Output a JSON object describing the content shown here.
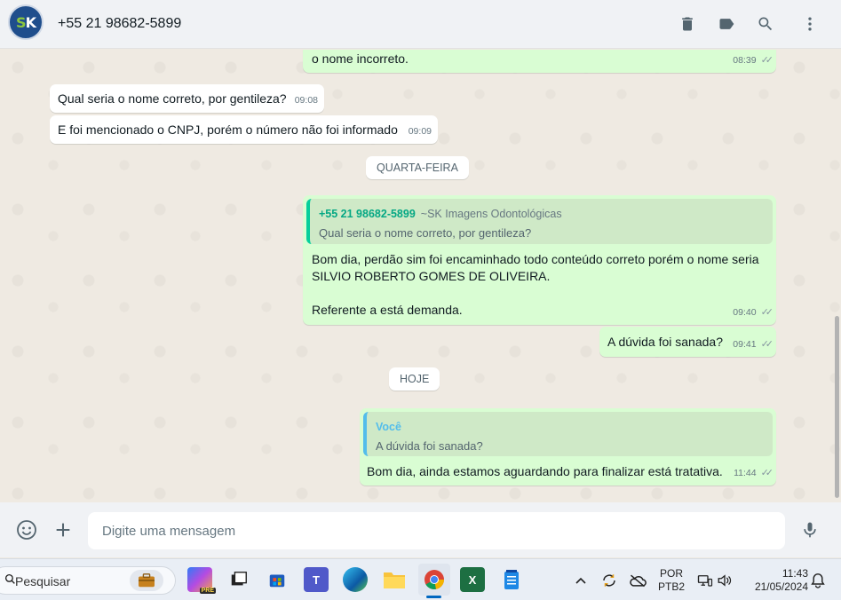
{
  "header": {
    "contact_name": "+55 21 98682-5899",
    "avatar_text_s": "S",
    "avatar_text_k": "K",
    "icons": [
      "delete-icon",
      "label-icon",
      "search-icon",
      "menu-icon"
    ]
  },
  "messages": [
    {
      "direction": "out",
      "text": "o nome incorreto.",
      "time": "08:39",
      "ticks": "✓✓"
    },
    {
      "direction": "in",
      "text": "Qual seria o nome correto, por gentileza?",
      "time": "09:08"
    },
    {
      "direction": "in",
      "text": "E foi mencionado o CNPJ, porém o número não foi informado",
      "time": "09:09"
    },
    {
      "direction": "out",
      "quote": {
        "author": "+55 21 98682-5899",
        "author_sub": "~SK Imagens Odontológicas",
        "text": "Qual seria o nome correto, por gentileza?"
      },
      "line1": "Bom dia, perdão sim foi encaminhado todo conteúdo correto porém o nome seria",
      "line2": "SILVIO ROBERTO GOMES DE OLIVEIRA.",
      "line3": "Referente a está demanda.",
      "time": "09:40",
      "ticks": "✓✓"
    },
    {
      "direction": "out",
      "text": "A dúvida foi sanada?",
      "time": "09:41",
      "ticks": "✓✓"
    },
    {
      "direction": "out",
      "quote": {
        "author": "Você",
        "text": "A dúvida foi sanada?"
      },
      "text": "Bom dia, ainda estamos aguardando para finalizar está tratativa.",
      "time": "11:44",
      "ticks": "✓✓"
    }
  ],
  "date_separators": {
    "wednesday": "QUARTA-FEIRA",
    "today": "HOJE"
  },
  "composer": {
    "placeholder": "Digite uma mensagem"
  },
  "taskbar": {
    "search_label": "Pesquisar",
    "language_line1": "POR",
    "language_line2": "PTB2",
    "time": "11:43",
    "date": "21/05/2024",
    "copilot_badge": "PRE"
  },
  "colors": {
    "outgoing_bubble": "#d9fdd3",
    "incoming_bubble": "#ffffff",
    "chat_background": "#efeae2",
    "accent_green": "#06cf9c",
    "quote_you": "#53bdeb"
  }
}
